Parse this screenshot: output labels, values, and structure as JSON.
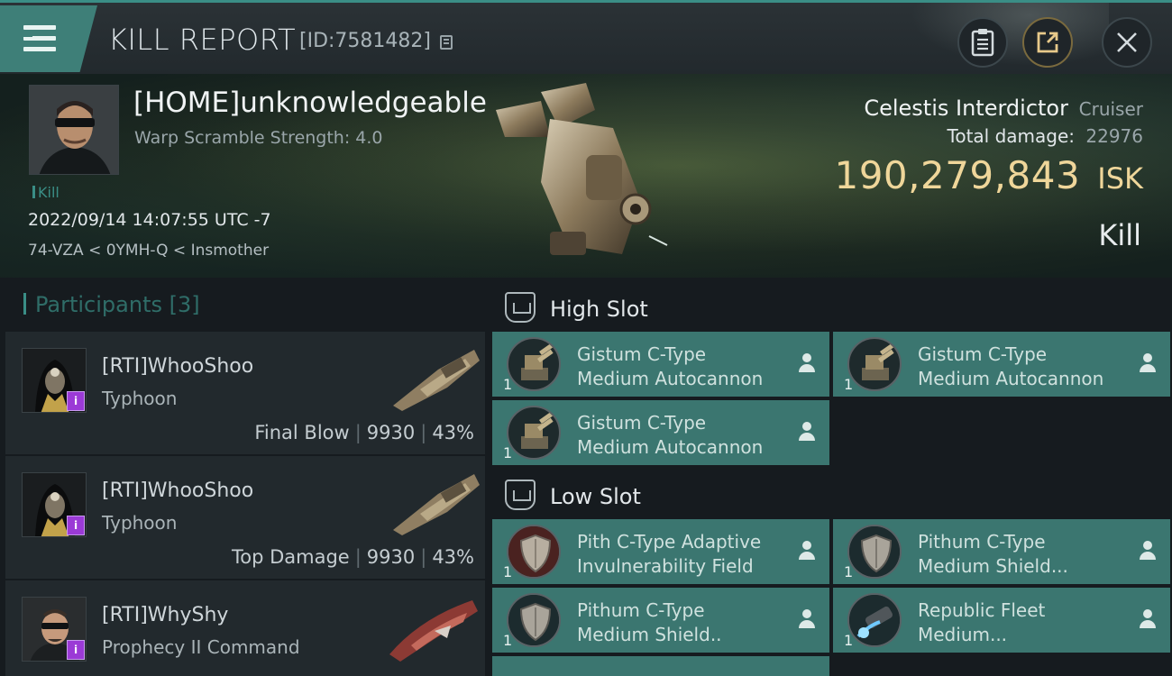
{
  "header": {
    "title": "KILL REPORT",
    "report_id": "[ID:7581482]"
  },
  "victim": {
    "name": "[HOME]unknowledgeable",
    "warp_scramble": "Warp Scramble Strength: 4.0",
    "kill_tag": "Kill",
    "timestamp": "2022/09/14 14:07:55 UTC -7",
    "location": "74-VZA < 0YMH-Q < Insmother",
    "ship_name": "Celestis Interdictor",
    "ship_class": "Cruiser",
    "total_damage_label": "Total damage:",
    "total_damage": "22976",
    "isk_value": "190,279,843",
    "isk_unit": "ISK",
    "result": "Kill"
  },
  "participants": {
    "header": "Participants [3]",
    "items": [
      {
        "name": "[RTI]WhooShoo",
        "ship": "Typhoon",
        "role": "Final Blow",
        "damage": "9930",
        "percent": "43%",
        "badge": "i"
      },
      {
        "name": "[RTI]WhooShoo",
        "ship": "Typhoon",
        "role": "Top Damage",
        "damage": "9930",
        "percent": "43%",
        "badge": "i"
      },
      {
        "name": "[RTI]WhyShy",
        "ship": "Prophecy II Command",
        "badge": "i"
      }
    ]
  },
  "fitting": {
    "high_slot_label": "High Slot",
    "low_slot_label": "Low Slot",
    "high": [
      {
        "line1": "Gistum C-Type",
        "line2": "Medium Autocannon",
        "qty": "1"
      },
      {
        "line1": "Gistum C-Type",
        "line2": "Medium Autocannon",
        "qty": "1"
      },
      {
        "line1": "Gistum C-Type",
        "line2": "Medium Autocannon",
        "qty": "1"
      }
    ],
    "low": [
      {
        "line1": "Pith C-Type Adaptive",
        "line2": "Invulnerability Field",
        "qty": "1"
      },
      {
        "line1": "Pithum C-Type",
        "line2": "Medium Shield...",
        "qty": "1"
      },
      {
        "line1": "Pithum C-Type",
        "line2": "Medium Shield..",
        "qty": "1"
      },
      {
        "line1": "Republic Fleet",
        "line2": "Medium...",
        "qty": "1"
      }
    ]
  }
}
